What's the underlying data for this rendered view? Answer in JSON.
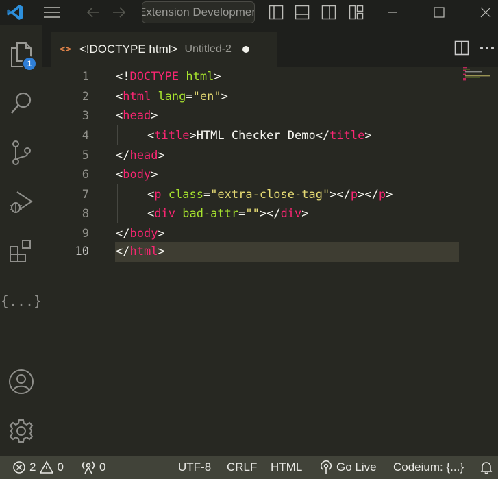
{
  "titlebar": {
    "command_center_text": "Extension Development Host",
    "icons": [
      "vscode-logo",
      "menu-icon",
      "arrow-left-icon",
      "arrow-right-icon",
      "toggle-primary-sidebar-icon",
      "toggle-panel-icon",
      "toggle-secondary-sidebar-icon",
      "customize-layout-icon",
      "minimize-icon",
      "maximize-icon",
      "close-icon"
    ]
  },
  "activity_bar": {
    "items": [
      {
        "name": "explorer",
        "icon": "files-icon",
        "badge": "1"
      },
      {
        "name": "search",
        "icon": "search-icon"
      },
      {
        "name": "source-control",
        "icon": "source-control-icon"
      },
      {
        "name": "run-and-debug",
        "icon": "run-debug-icon"
      },
      {
        "name": "extensions",
        "icon": "extensions-icon"
      },
      {
        "name": "json",
        "icon": "braces-icon",
        "label": "{...}"
      }
    ],
    "bottom": [
      {
        "name": "accounts",
        "icon": "account-icon"
      },
      {
        "name": "manage",
        "icon": "gear-icon"
      }
    ]
  },
  "tab": {
    "icon_glyph": "<>",
    "title": "<!DOCTYPE html>",
    "description": "Untitled-2",
    "dirty": true
  },
  "editor": {
    "lines": [
      {
        "num": "1"
      },
      {
        "num": "2"
      },
      {
        "num": "3"
      },
      {
        "num": "4"
      },
      {
        "num": "5"
      },
      {
        "num": "6"
      },
      {
        "num": "7"
      },
      {
        "num": "8"
      },
      {
        "num": "9"
      },
      {
        "num": "10"
      }
    ],
    "tokens": {
      "l1": [
        "<!",
        "DOCTYPE",
        " ",
        "html",
        ">"
      ],
      "l2": [
        "<",
        "html",
        " ",
        "lang",
        "=",
        "\"en\"",
        ">"
      ],
      "l3": [
        "<",
        "head",
        ">"
      ],
      "l4": [
        "<",
        "title",
        ">",
        "HTML Checker Demo",
        "</",
        "title",
        ">"
      ],
      "l5": [
        "</",
        "head",
        ">"
      ],
      "l6": [
        "<",
        "body",
        ">"
      ],
      "l7": [
        "<",
        "p",
        " ",
        "class",
        "=",
        "\"extra-close-tag\"",
        "></",
        "p",
        "></",
        "p",
        ">"
      ],
      "l8": [
        "<",
        "div",
        " ",
        "bad-attr",
        "=",
        "\"\"",
        "></",
        "div",
        ">"
      ],
      "l9": [
        "</",
        "body",
        ">"
      ],
      "l10": [
        "</",
        "html",
        ">"
      ]
    },
    "active_line": "10",
    "colors": {
      "tag": "#f92672",
      "attr": "#a6e22e",
      "string": "#e6db74",
      "text": "#f8f8f2",
      "background": "#272822"
    }
  },
  "statusbar": {
    "errors": "2",
    "warnings": "0",
    "ports": "0",
    "encoding": "UTF-8",
    "eol": "CRLF",
    "language": "HTML",
    "go_live": "Go Live",
    "codeium": "Codeium: {...}"
  }
}
